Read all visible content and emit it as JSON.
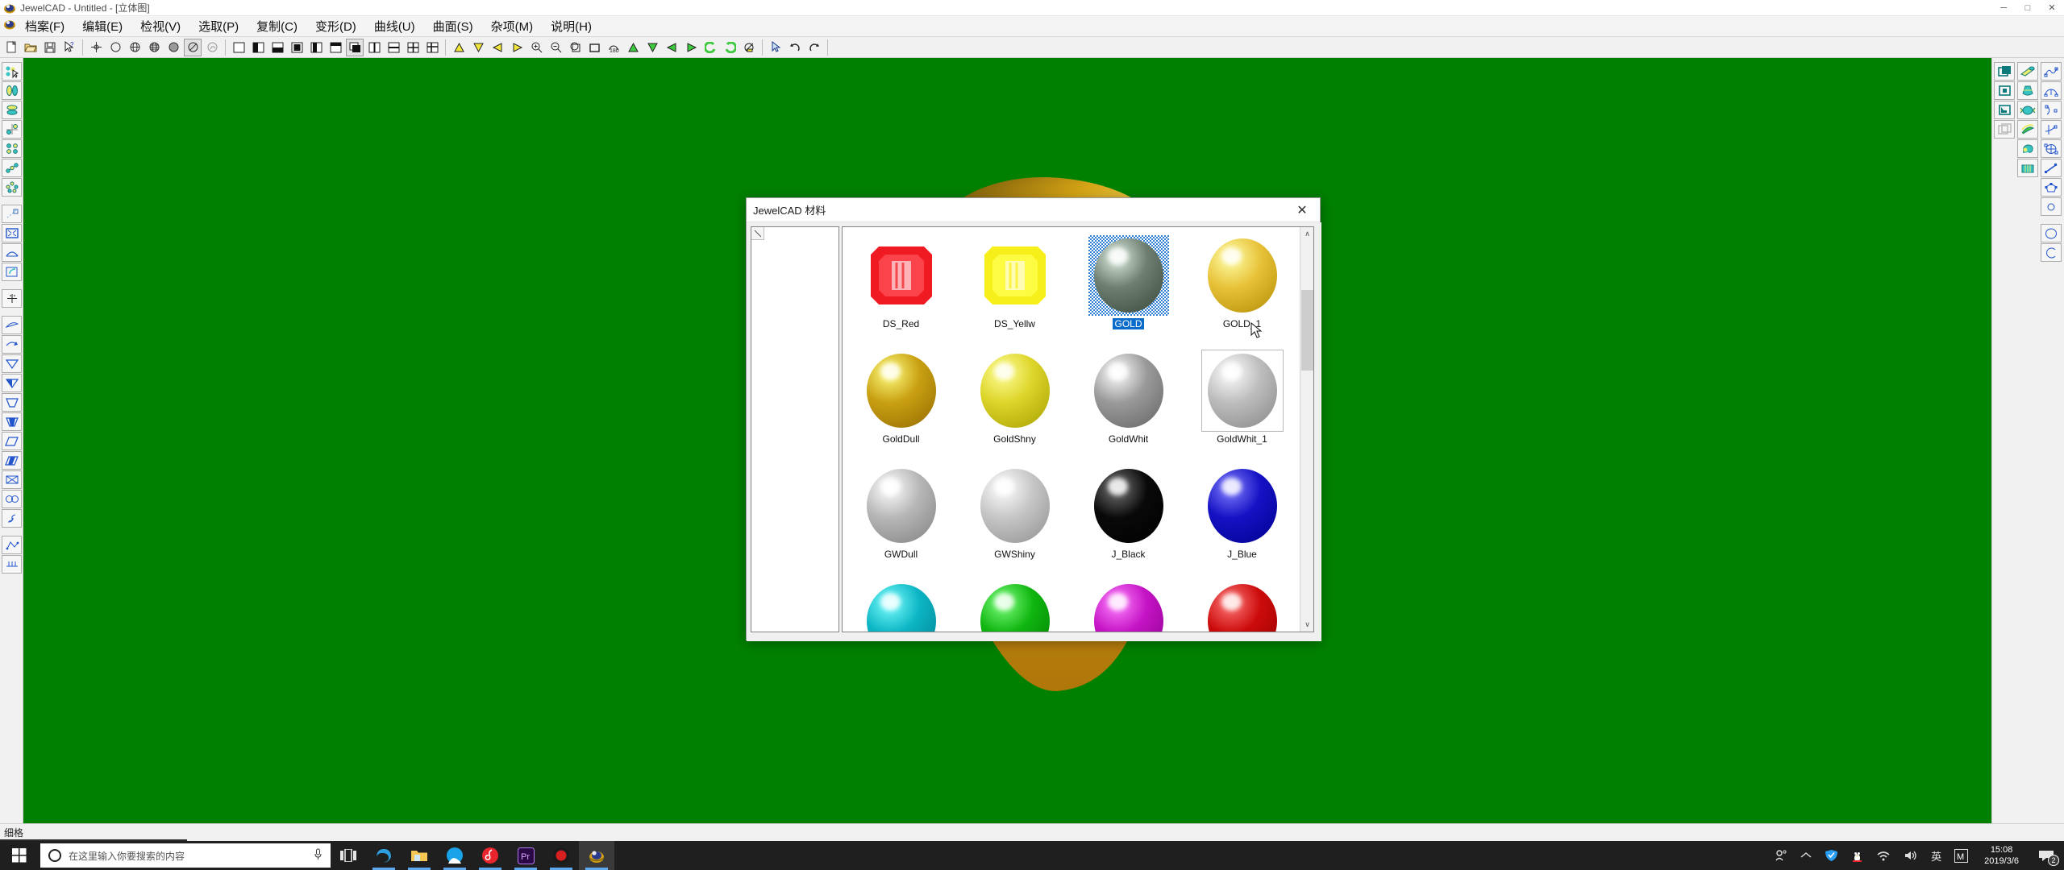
{
  "window": {
    "title": "JewelCAD - Untitled - [立体图]",
    "icon": "jewelcad-app-icon",
    "controls": {
      "minimize": "─",
      "maximize": "□",
      "close": "✕"
    }
  },
  "menubar": {
    "icon": "jewelcad-menu-icon",
    "items": [
      {
        "label": "档案(F)",
        "name": "menu-file"
      },
      {
        "label": "编辑(E)",
        "name": "menu-edit"
      },
      {
        "label": "检视(V)",
        "name": "menu-view"
      },
      {
        "label": "选取(P)",
        "name": "menu-select"
      },
      {
        "label": "复制(C)",
        "name": "menu-copy"
      },
      {
        "label": "变形(D)",
        "name": "menu-deform"
      },
      {
        "label": "曲线(U)",
        "name": "menu-curve"
      },
      {
        "label": "曲面(S)",
        "name": "menu-surface"
      },
      {
        "label": "杂项(M)",
        "name": "menu-misc"
      },
      {
        "label": "说明(H)",
        "name": "menu-help"
      }
    ]
  },
  "toolbar": {
    "groups": [
      [
        "new-file-icon",
        "open-file-icon",
        "save-file-icon",
        "help-pointer-icon"
      ],
      [
        "point-icon",
        "circle-outline-icon",
        "sphere-wire-icon",
        "globe-wire-icon",
        "sphere-solid-icon",
        "shade-nolight-icon",
        "render-icon"
      ],
      [
        "view-full-icon",
        "view-left-half-icon",
        "view-bottom-half-icon",
        "view-center-icon",
        "view-right-half-icon",
        "view-top-frame-icon",
        "view-shadow-icon",
        "split-vertical-icon",
        "split-horizontal-icon",
        "grid-four-icon",
        "grid-four-alt-icon"
      ],
      [
        "triangle-up-yellow-icon",
        "triangle-down-yellow-icon",
        "triangle-left-yellow-icon",
        "triangle-right-yellow-icon",
        "zoom-in-icon",
        "zoom-out-icon",
        "zoom-window-icon",
        "zoom-fit-icon",
        "rotate-180-icon",
        "triangle-up-green-icon",
        "triangle-down-green-icon",
        "triangle-left-green-icon",
        "triangle-right-green-icon",
        "rotate-ccw-icon",
        "rotate-cw-icon",
        "render-scene-icon"
      ],
      [
        "select-arrow-icon",
        "undo-icon",
        "redo-icon"
      ]
    ]
  },
  "left_rail": {
    "items": [
      "select-objects-icon",
      "mirror-vertical-icon",
      "mirror-horizontal-icon",
      "array-quadrant-icon",
      "array-grid-icon",
      "array-linear-icon",
      "array-circular-icon",
      "scale-diagonal-icon",
      "scale-box-icon",
      "arch-icon",
      "flip-icon",
      "move-cross-icon",
      "curve-arc-icon",
      "curve-arrow-icon",
      "taper-outline-icon",
      "taper-half-icon",
      "trapezoid-outline-icon",
      "trapezoid-filled-icon",
      "parallelogram-outline-icon",
      "parallelogram-filled-icon",
      "bowtie-icon",
      "infinity-icon",
      "wave-icon",
      "polyline-icon",
      "comb-icon"
    ]
  },
  "right_rail": {
    "col1": [
      "layer-front-icon",
      "layer-solid-icon",
      "layer-corner-icon",
      "layer-ghost-icon"
    ],
    "col2": [
      "extrude-tube-icon",
      "revolve-vase-icon",
      "lathe-spool-icon",
      "twist-coil-icon",
      "sweep-hook-icon",
      "loft-band-icon"
    ],
    "col3": [
      "curve-spline-icon",
      "curve-arc-node-icon",
      "curve-half-arc-icon",
      "curve-axis-icon",
      "curve-ellipse-node-icon",
      "curve-line-node-icon",
      "curve-polygon-node-icon",
      "circle-small-icon",
      "circle-large-icon",
      "arc-open-icon"
    ]
  },
  "statusbar": {
    "text": "细格"
  },
  "dialog": {
    "title": "JewelCAD 材料",
    "close_label": "✕",
    "left_panel": {
      "corner_icon": "resize-handle-icon",
      "items": []
    },
    "scrollbar": {
      "up": "∧",
      "down": "∨"
    },
    "materials": [
      {
        "label": "DS_Red",
        "kind": "gem",
        "color": "#f01b22",
        "selected": false,
        "boxed": false
      },
      {
        "label": "DS_Yellw",
        "kind": "gem",
        "color": "#f7ef19",
        "selected": false,
        "boxed": false
      },
      {
        "label": "GOLD",
        "kind": "sphere",
        "color": "#6e7f72",
        "selected": true,
        "boxed": false
      },
      {
        "label": "GOLD_1",
        "kind": "sphere",
        "color": "#e8c33a",
        "selected": false,
        "boxed": false
      },
      {
        "label": "GoldDull",
        "kind": "sphere",
        "color": "#c9a012",
        "selected": false,
        "boxed": false
      },
      {
        "label": "GoldShny",
        "kind": "sphere",
        "color": "#ddd52a",
        "selected": false,
        "boxed": false
      },
      {
        "label": "GoldWhit",
        "kind": "sphere",
        "color": "#9a9a9a",
        "selected": false,
        "boxed": false
      },
      {
        "label": "GoldWhit_1",
        "kind": "sphere",
        "color": "#bdbdbd",
        "selected": false,
        "boxed": true
      },
      {
        "label": "GWDull",
        "kind": "sphere",
        "color": "#b7b7b7",
        "selected": false,
        "boxed": false
      },
      {
        "label": "GWShiny",
        "kind": "sphere",
        "color": "#c6c6c6",
        "selected": false,
        "boxed": false
      },
      {
        "label": "J_Black",
        "kind": "sphere",
        "color": "#090909",
        "selected": false,
        "boxed": false
      },
      {
        "label": "J_Blue",
        "kind": "sphere",
        "color": "#1512c4",
        "selected": false,
        "boxed": false
      },
      {
        "label": "",
        "kind": "sphere",
        "color": "#0cb5c4",
        "selected": false,
        "boxed": false
      },
      {
        "label": "",
        "kind": "sphere",
        "color": "#10b510",
        "selected": false,
        "boxed": false
      },
      {
        "label": "",
        "kind": "sphere",
        "color": "#c413c4",
        "selected": false,
        "boxed": false
      },
      {
        "label": "",
        "kind": "sphere",
        "color": "#cc0b0b",
        "selected": false,
        "boxed": false
      }
    ]
  },
  "taskbar": {
    "start_icon": "windows-start-icon",
    "search": {
      "placeholder": "在这里输入你要搜索的内容",
      "mic_icon": "microphone-icon",
      "circle_icon": "cortana-circle-icon"
    },
    "buttons": [
      {
        "name": "task-view-icon",
        "running": false
      },
      {
        "name": "edge-browser-icon",
        "running": true
      },
      {
        "name": "file-explorer-icon",
        "running": true
      },
      {
        "name": "qq-browser-icon",
        "running": true
      },
      {
        "name": "netease-music-icon",
        "running": true
      },
      {
        "name": "premiere-pro-icon",
        "running": true
      },
      {
        "name": "screen-recorder-icon",
        "running": true
      },
      {
        "name": "jewelcad-icon",
        "running": true
      }
    ],
    "tray": {
      "icons": [
        "people-icon",
        "show-hidden-icons-chevron",
        "security-shield-icon",
        "qq-penguin-icon",
        "wifi-icon",
        "volume-icon",
        "ime-chinese-icon",
        "ime-mode-icon"
      ],
      "ime_chinese_label": "英",
      "ime_mode_label": "M",
      "clock": {
        "time": "15:08",
        "date": "2019/3/6"
      },
      "notification": {
        "icon": "action-center-icon",
        "count": "2"
      }
    }
  },
  "colors": {
    "canvas_green": "#008000",
    "accent_blue": "#0a6cca",
    "taskbar": "#1f1f1f"
  }
}
